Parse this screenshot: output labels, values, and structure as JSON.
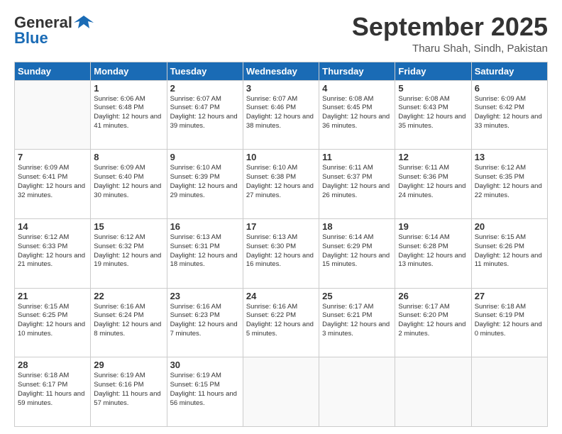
{
  "logo": {
    "text_general": "General",
    "text_blue": "Blue"
  },
  "header": {
    "month": "September 2025",
    "location": "Tharu Shah, Sindh, Pakistan"
  },
  "weekdays": [
    "Sunday",
    "Monday",
    "Tuesday",
    "Wednesday",
    "Thursday",
    "Friday",
    "Saturday"
  ],
  "weeks": [
    [
      {
        "day": "",
        "sunrise": "",
        "sunset": "",
        "daylight": ""
      },
      {
        "day": "1",
        "sunrise": "Sunrise: 6:06 AM",
        "sunset": "Sunset: 6:48 PM",
        "daylight": "Daylight: 12 hours and 41 minutes."
      },
      {
        "day": "2",
        "sunrise": "Sunrise: 6:07 AM",
        "sunset": "Sunset: 6:47 PM",
        "daylight": "Daylight: 12 hours and 39 minutes."
      },
      {
        "day": "3",
        "sunrise": "Sunrise: 6:07 AM",
        "sunset": "Sunset: 6:46 PM",
        "daylight": "Daylight: 12 hours and 38 minutes."
      },
      {
        "day": "4",
        "sunrise": "Sunrise: 6:08 AM",
        "sunset": "Sunset: 6:45 PM",
        "daylight": "Daylight: 12 hours and 36 minutes."
      },
      {
        "day": "5",
        "sunrise": "Sunrise: 6:08 AM",
        "sunset": "Sunset: 6:43 PM",
        "daylight": "Daylight: 12 hours and 35 minutes."
      },
      {
        "day": "6",
        "sunrise": "Sunrise: 6:09 AM",
        "sunset": "Sunset: 6:42 PM",
        "daylight": "Daylight: 12 hours and 33 minutes."
      }
    ],
    [
      {
        "day": "7",
        "sunrise": "Sunrise: 6:09 AM",
        "sunset": "Sunset: 6:41 PM",
        "daylight": "Daylight: 12 hours and 32 minutes."
      },
      {
        "day": "8",
        "sunrise": "Sunrise: 6:09 AM",
        "sunset": "Sunset: 6:40 PM",
        "daylight": "Daylight: 12 hours and 30 minutes."
      },
      {
        "day": "9",
        "sunrise": "Sunrise: 6:10 AM",
        "sunset": "Sunset: 6:39 PM",
        "daylight": "Daylight: 12 hours and 29 minutes."
      },
      {
        "day": "10",
        "sunrise": "Sunrise: 6:10 AM",
        "sunset": "Sunset: 6:38 PM",
        "daylight": "Daylight: 12 hours and 27 minutes."
      },
      {
        "day": "11",
        "sunrise": "Sunrise: 6:11 AM",
        "sunset": "Sunset: 6:37 PM",
        "daylight": "Daylight: 12 hours and 26 minutes."
      },
      {
        "day": "12",
        "sunrise": "Sunrise: 6:11 AM",
        "sunset": "Sunset: 6:36 PM",
        "daylight": "Daylight: 12 hours and 24 minutes."
      },
      {
        "day": "13",
        "sunrise": "Sunrise: 6:12 AM",
        "sunset": "Sunset: 6:35 PM",
        "daylight": "Daylight: 12 hours and 22 minutes."
      }
    ],
    [
      {
        "day": "14",
        "sunrise": "Sunrise: 6:12 AM",
        "sunset": "Sunset: 6:33 PM",
        "daylight": "Daylight: 12 hours and 21 minutes."
      },
      {
        "day": "15",
        "sunrise": "Sunrise: 6:12 AM",
        "sunset": "Sunset: 6:32 PM",
        "daylight": "Daylight: 12 hours and 19 minutes."
      },
      {
        "day": "16",
        "sunrise": "Sunrise: 6:13 AM",
        "sunset": "Sunset: 6:31 PM",
        "daylight": "Daylight: 12 hours and 18 minutes."
      },
      {
        "day": "17",
        "sunrise": "Sunrise: 6:13 AM",
        "sunset": "Sunset: 6:30 PM",
        "daylight": "Daylight: 12 hours and 16 minutes."
      },
      {
        "day": "18",
        "sunrise": "Sunrise: 6:14 AM",
        "sunset": "Sunset: 6:29 PM",
        "daylight": "Daylight: 12 hours and 15 minutes."
      },
      {
        "day": "19",
        "sunrise": "Sunrise: 6:14 AM",
        "sunset": "Sunset: 6:28 PM",
        "daylight": "Daylight: 12 hours and 13 minutes."
      },
      {
        "day": "20",
        "sunrise": "Sunrise: 6:15 AM",
        "sunset": "Sunset: 6:26 PM",
        "daylight": "Daylight: 12 hours and 11 minutes."
      }
    ],
    [
      {
        "day": "21",
        "sunrise": "Sunrise: 6:15 AM",
        "sunset": "Sunset: 6:25 PM",
        "daylight": "Daylight: 12 hours and 10 minutes."
      },
      {
        "day": "22",
        "sunrise": "Sunrise: 6:16 AM",
        "sunset": "Sunset: 6:24 PM",
        "daylight": "Daylight: 12 hours and 8 minutes."
      },
      {
        "day": "23",
        "sunrise": "Sunrise: 6:16 AM",
        "sunset": "Sunset: 6:23 PM",
        "daylight": "Daylight: 12 hours and 7 minutes."
      },
      {
        "day": "24",
        "sunrise": "Sunrise: 6:16 AM",
        "sunset": "Sunset: 6:22 PM",
        "daylight": "Daylight: 12 hours and 5 minutes."
      },
      {
        "day": "25",
        "sunrise": "Sunrise: 6:17 AM",
        "sunset": "Sunset: 6:21 PM",
        "daylight": "Daylight: 12 hours and 3 minutes."
      },
      {
        "day": "26",
        "sunrise": "Sunrise: 6:17 AM",
        "sunset": "Sunset: 6:20 PM",
        "daylight": "Daylight: 12 hours and 2 minutes."
      },
      {
        "day": "27",
        "sunrise": "Sunrise: 6:18 AM",
        "sunset": "Sunset: 6:19 PM",
        "daylight": "Daylight: 12 hours and 0 minutes."
      }
    ],
    [
      {
        "day": "28",
        "sunrise": "Sunrise: 6:18 AM",
        "sunset": "Sunset: 6:17 PM",
        "daylight": "Daylight: 11 hours and 59 minutes."
      },
      {
        "day": "29",
        "sunrise": "Sunrise: 6:19 AM",
        "sunset": "Sunset: 6:16 PM",
        "daylight": "Daylight: 11 hours and 57 minutes."
      },
      {
        "day": "30",
        "sunrise": "Sunrise: 6:19 AM",
        "sunset": "Sunset: 6:15 PM",
        "daylight": "Daylight: 11 hours and 56 minutes."
      },
      {
        "day": "",
        "sunrise": "",
        "sunset": "",
        "daylight": ""
      },
      {
        "day": "",
        "sunrise": "",
        "sunset": "",
        "daylight": ""
      },
      {
        "day": "",
        "sunrise": "",
        "sunset": "",
        "daylight": ""
      },
      {
        "day": "",
        "sunrise": "",
        "sunset": "",
        "daylight": ""
      }
    ]
  ]
}
